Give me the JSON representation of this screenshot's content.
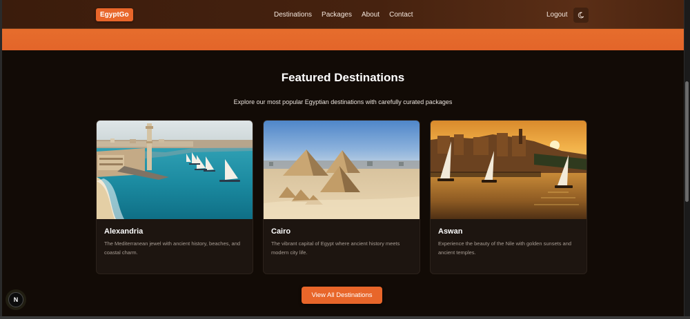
{
  "navbar": {
    "brand": "EgyptGo",
    "links": [
      "Destinations",
      "Packages",
      "About",
      "Contact"
    ],
    "logout": "Logout",
    "theme_icon": "moon-icon"
  },
  "featured": {
    "title": "Featured Destinations",
    "subtitle": "Explore our most popular Egyptian destinations with carefully curated packages",
    "cards": [
      {
        "name": "Alexandria",
        "description": "The Mediterranean jewel with ancient history, beaches, and coastal charm.",
        "image": "alexandria-coast-image"
      },
      {
        "name": "Cairo",
        "description": "The vibrant capital of Egypt where ancient history meets modern city life.",
        "image": "giza-pyramids-image"
      },
      {
        "name": "Aswan",
        "description": "Experience the beauty of the Nile with golden sunsets and ancient temples.",
        "image": "nile-sunset-image"
      }
    ],
    "cta": "View All Destinations"
  },
  "badge": {
    "label": "N"
  },
  "colors": {
    "accent": "#e8662a",
    "navbar": "#46220f",
    "background": "#120b06",
    "card": "#1d1510"
  }
}
